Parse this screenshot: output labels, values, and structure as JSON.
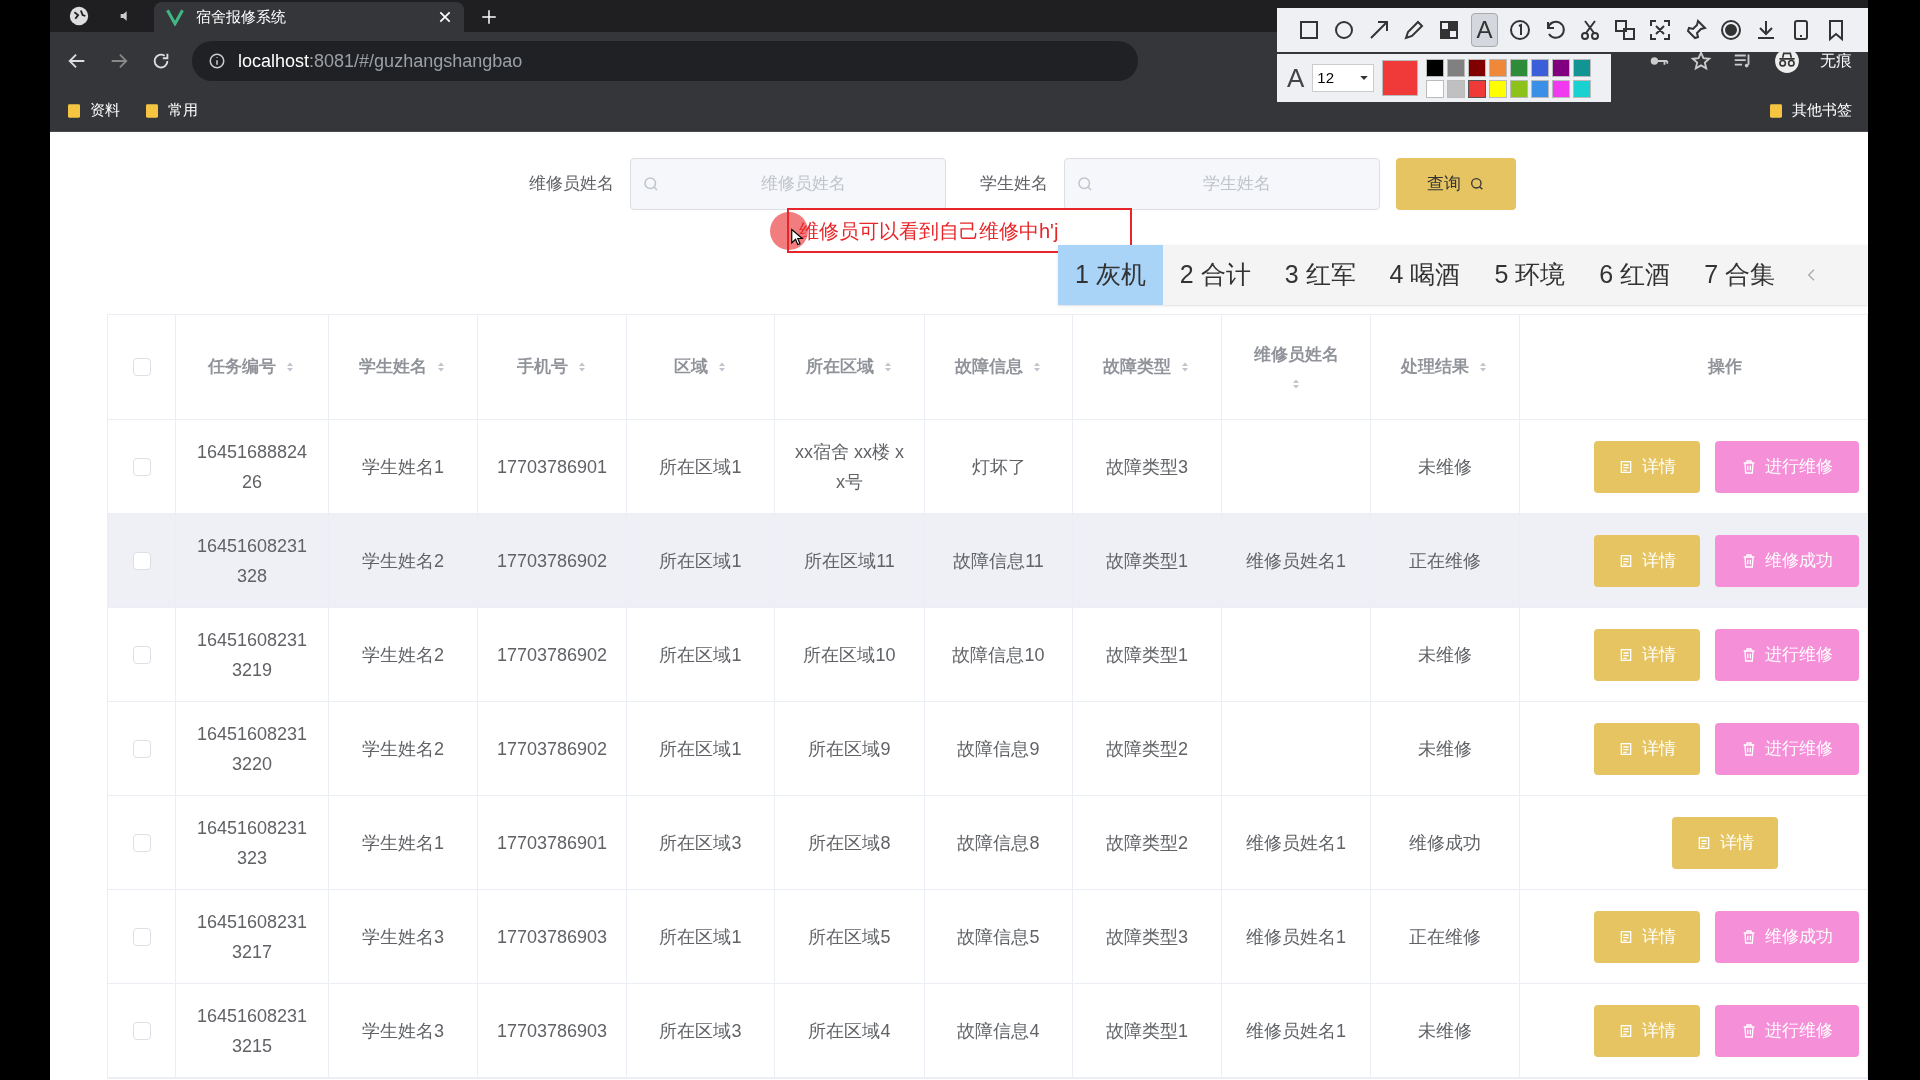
{
  "browser": {
    "tab_title": "宿舍报修系统",
    "url_host": "localhost",
    "url_rest": ":8081/#/guzhangshangbao",
    "bookmarks": [
      "资料",
      "常用"
    ],
    "other_bookmarks": "其他书签",
    "profile": "无痕"
  },
  "annotation_toolbar": {
    "tools": [
      {
        "kind": "rect",
        "selected": false
      },
      {
        "kind": "circle",
        "selected": false
      },
      {
        "kind": "arrow",
        "selected": false
      },
      {
        "kind": "pencil",
        "selected": false
      },
      {
        "kind": "mosaic",
        "selected": false
      },
      {
        "kind": "text",
        "label": "A",
        "selected": true
      },
      {
        "kind": "number",
        "selected": false
      },
      {
        "kind": "undo",
        "selected": false
      },
      {
        "kind": "cut",
        "selected": false
      },
      {
        "kind": "translate",
        "selected": false
      },
      {
        "kind": "ocr",
        "selected": false
      },
      {
        "kind": "pin",
        "selected": false
      },
      {
        "kind": "record",
        "selected": false
      },
      {
        "kind": "download",
        "selected": false
      },
      {
        "kind": "phone",
        "selected": false
      },
      {
        "kind": "bookmark",
        "selected": false
      }
    ],
    "font_label": "A",
    "font_size": "12",
    "palette": [
      {
        "color": "#000000",
        "selected": false
      },
      {
        "color": "#808080",
        "selected": false
      },
      {
        "color": "#800000",
        "selected": false
      },
      {
        "color": "#f0883a",
        "selected": false
      },
      {
        "color": "#2e8b3a",
        "selected": false
      },
      {
        "color": "#3a5fd8",
        "selected": false
      },
      {
        "color": "#800080",
        "selected": false
      },
      {
        "color": "#139494",
        "selected": false
      },
      {
        "color": "#ffffff",
        "selected": false
      },
      {
        "color": "#c0c0c0",
        "selected": false
      },
      {
        "color": "#f03a3a",
        "selected": true
      },
      {
        "color": "#ffff00",
        "selected": false
      },
      {
        "color": "#8cc21a",
        "selected": false
      },
      {
        "color": "#3a8fe6",
        "selected": false
      },
      {
        "color": "#f03af0",
        "selected": false
      },
      {
        "color": "#1ad1d1",
        "selected": false
      }
    ]
  },
  "search": {
    "fields": [
      {
        "label": "维修员姓名",
        "placeholder": "维修员姓名"
      },
      {
        "label": "学生姓名",
        "placeholder": "学生姓名"
      }
    ],
    "button": "查询"
  },
  "annotation": {
    "text": "维修员可以看到自己维修中h'j"
  },
  "ime": {
    "candidates": [
      {
        "number": "1",
        "word": "灰机",
        "selected": true
      },
      {
        "number": "2",
        "word": "合计",
        "selected": false
      },
      {
        "number": "3",
        "word": "红军",
        "selected": false
      },
      {
        "number": "4",
        "word": "喝酒",
        "selected": false
      },
      {
        "number": "5",
        "word": "环境",
        "selected": false
      },
      {
        "number": "6",
        "word": "红酒",
        "selected": false
      },
      {
        "number": "7",
        "word": "合集",
        "selected": false
      }
    ]
  },
  "table": {
    "header_checked": false,
    "columns": [
      {
        "label": "任务编号",
        "sortable": true
      },
      {
        "label": "学生姓名",
        "sortable": true
      },
      {
        "label": "手机号",
        "sortable": true
      },
      {
        "label": "区域",
        "sortable": true
      },
      {
        "label": "所在区域",
        "sortable": true
      },
      {
        "label": "故障信息",
        "sortable": true
      },
      {
        "label": "故障类型",
        "sortable": true
      },
      {
        "label": "维修员姓名",
        "sortable": true
      },
      {
        "label": "处理结果",
        "sortable": true
      },
      {
        "label": "操作",
        "sortable": false
      }
    ],
    "rows": [
      {
        "checked": false,
        "highlighted": false,
        "cells": [
          "1645168882426",
          "学生姓名1",
          "17703786901",
          "所在区域1",
          "xx宿舍 xx楼 xx号",
          "灯坏了",
          "故障类型3",
          "",
          "未维修"
        ],
        "actions": [
          {
            "kind": "detail",
            "label": "详情"
          },
          {
            "kind": "repair",
            "label": "进行维修"
          }
        ]
      },
      {
        "checked": false,
        "highlighted": true,
        "cells": [
          "16451608231328",
          "学生姓名2",
          "17703786902",
          "所在区域1",
          "所在区域11",
          "故障信息11",
          "故障类型1",
          "维修员姓名1",
          "正在维修"
        ],
        "actions": [
          {
            "kind": "detail",
            "label": "详情"
          },
          {
            "kind": "repair",
            "label": "维修成功"
          }
        ]
      },
      {
        "checked": false,
        "highlighted": false,
        "cells": [
          "164516082313219",
          "学生姓名2",
          "17703786902",
          "所在区域1",
          "所在区域10",
          "故障信息10",
          "故障类型1",
          "",
          "未维修"
        ],
        "actions": [
          {
            "kind": "detail",
            "label": "详情"
          },
          {
            "kind": "repair",
            "label": "进行维修"
          }
        ]
      },
      {
        "checked": false,
        "highlighted": false,
        "cells": [
          "164516082313220",
          "学生姓名2",
          "17703786902",
          "所在区域1",
          "所在区域9",
          "故障信息9",
          "故障类型2",
          "",
          "未维修"
        ],
        "actions": [
          {
            "kind": "detail",
            "label": "详情"
          },
          {
            "kind": "repair",
            "label": "进行维修"
          }
        ]
      },
      {
        "checked": false,
        "highlighted": false,
        "cells": [
          "16451608231323",
          "学生姓名1",
          "17703786901",
          "所在区域3",
          "所在区域8",
          "故障信息8",
          "故障类型2",
          "维修员姓名1",
          "维修成功"
        ],
        "actions": [
          {
            "kind": "detail",
            "label": "详情"
          }
        ]
      },
      {
        "checked": false,
        "highlighted": false,
        "cells": [
          "164516082313217",
          "学生姓名3",
          "17703786903",
          "所在区域1",
          "所在区域5",
          "故障信息5",
          "故障类型3",
          "维修员姓名1",
          "正在维修"
        ],
        "actions": [
          {
            "kind": "detail",
            "label": "详情"
          },
          {
            "kind": "repair",
            "label": "维修成功"
          }
        ]
      },
      {
        "checked": false,
        "highlighted": false,
        "cells": [
          "164516082313215",
          "学生姓名3",
          "17703786903",
          "所在区域3",
          "所在区域4",
          "故障信息4",
          "故障类型1",
          "维修员姓名1",
          "未维修"
        ],
        "actions": [
          {
            "kind": "detail",
            "label": "详情"
          },
          {
            "kind": "repair",
            "label": "进行维修"
          }
        ]
      }
    ]
  }
}
